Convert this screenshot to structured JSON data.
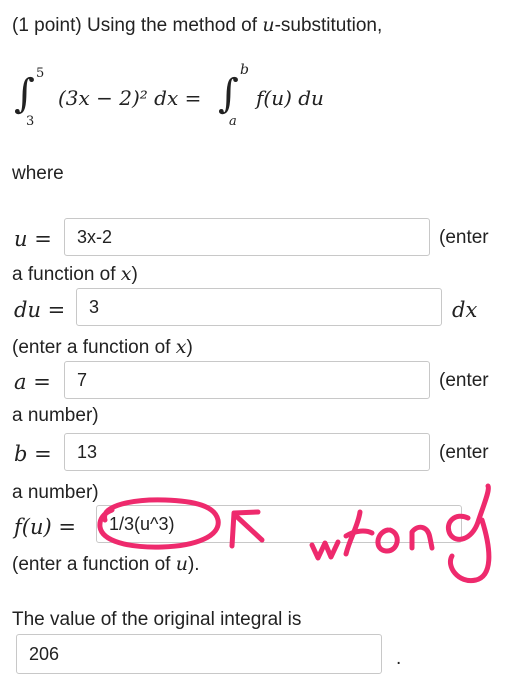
{
  "intro": {
    "text_prefix": "(1 point) Using the method of ",
    "var_u": "u",
    "text_suffix": "-substitution,"
  },
  "integral": {
    "lower": "3",
    "upper": "5",
    "integrand": "(3x − 2)² dx =",
    "rhs_lower": "a",
    "rhs_upper": "b",
    "rhs_integrand": "f(u) du"
  },
  "where_text": "where",
  "fields": {
    "u": {
      "label": "u =",
      "value": "3x-2",
      "suffix": "(enter",
      "note_prefix": "a function of ",
      "note_var": "x",
      "note_suffix": ")"
    },
    "du": {
      "label": "du =",
      "value": "3",
      "suffix": "dx",
      "note_prefix": "(enter a function of ",
      "note_var": "x",
      "note_suffix": ")"
    },
    "a": {
      "label": "a =",
      "value": "7",
      "suffix": "(enter",
      "note": "a number)"
    },
    "b": {
      "label": "b =",
      "value": "13",
      "suffix": "(enter",
      "note": "a number)"
    },
    "f": {
      "label": "f(u) =",
      "value": "1/3(u^3)",
      "note_prefix": "(enter a function of ",
      "note_var": "u",
      "note_suffix": ")."
    }
  },
  "original": {
    "prompt": "The value of the original integral is",
    "value": "206",
    "suffix": "."
  },
  "annotation": {
    "handwritten_word": "wrong",
    "ink_color": "#ee2a6d"
  }
}
